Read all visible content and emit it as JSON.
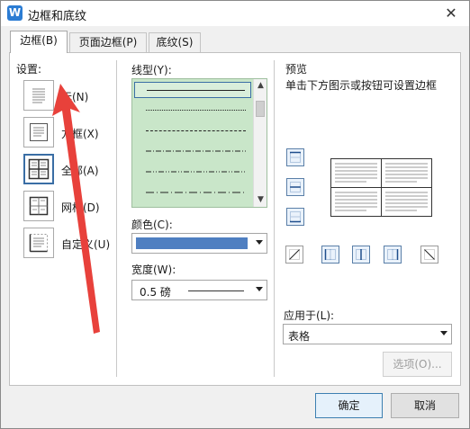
{
  "window": {
    "title": "边框和底纹",
    "app_icon": "W"
  },
  "tabs": [
    {
      "label": "边框(B)",
      "active": true
    },
    {
      "label": "页面边框(P)",
      "active": false
    },
    {
      "label": "底纹(S)",
      "active": false
    }
  ],
  "settings": {
    "label": "设置:",
    "items": [
      {
        "label": "无(N)",
        "icon": "none-border-icon",
        "selected": false
      },
      {
        "label": "方框(X)",
        "icon": "box-border-icon",
        "selected": false
      },
      {
        "label": "全部(A)",
        "icon": "all-border-icon",
        "selected": true
      },
      {
        "label": "网格(D)",
        "icon": "grid-border-icon",
        "selected": false
      },
      {
        "label": "自定义(U)",
        "icon": "custom-border-icon",
        "selected": false
      }
    ]
  },
  "line_style": {
    "label": "线型(Y):",
    "items": [
      "solid",
      "dotted",
      "dashed",
      "dash-dot",
      "dash-dot-dot",
      "long-dash-dot"
    ],
    "selected_index": 0
  },
  "color": {
    "label": "颜色(C):",
    "value": "#4f7fc1"
  },
  "width": {
    "label": "宽度(W):",
    "value": "0.5 磅"
  },
  "preview": {
    "label": "预览",
    "description": "单击下方图示或按钮可设置边框"
  },
  "apply_to": {
    "label": "应用于(L):",
    "value": "表格"
  },
  "options_button": "选项(O)...",
  "ok_button": "确定",
  "cancel_button": "取消",
  "colors": {
    "annotation_arrow": "#e8413b",
    "accent": "#3a6ea5"
  }
}
